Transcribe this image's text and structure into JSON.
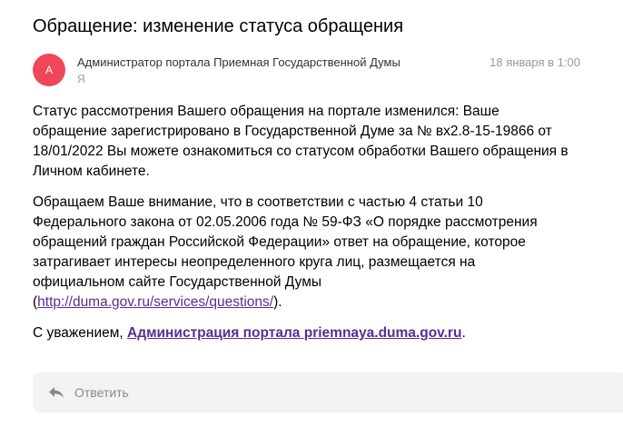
{
  "email": {
    "subject": "Обращение: изменение статуса обращения",
    "avatar_letter": "А",
    "avatar_color": "#f0465a",
    "sender": "Администратор портала Приемная Государственной Думы",
    "recipient": "Я",
    "date": "18 января в 1:00"
  },
  "body": {
    "p1": [
      "Статус рассмотрения Вашего обращения на портале изменился: Ваше",
      "обращение зарегистрировано в Государственной Думе за № вх2.8-15-19866 от",
      "18/01/2022 Вы можете ознакомиться со статусом обработки Вашего обращения в",
      "Личном кабинете."
    ],
    "p2": [
      "Обращаем Ваше внимание, что в соответствии с частью 4 статьи 10",
      "Федерального закона от 02.05.2006 года № 59-ФЗ «О порядке рассмотрения",
      "обращений граждан Российской Федерации» ответ на обращение, которое",
      "затрагивает интересы неопределенного круга лиц, размещается на",
      "официальном сайте Государственной Думы"
    ],
    "p2_link_open": "(",
    "p2_link": "http://duma.gov.ru/services/questions/",
    "p2_link_close": ").",
    "signature_prefix": "С уважением, ",
    "signature_link": "Администрация портала priemnaya.duma.gov.ru",
    "signature_suffix": "."
  },
  "reply": {
    "label": "Ответить",
    "icon": "reply-arrow-icon"
  },
  "colors": {
    "link": "#5a2d91",
    "muted": "#999999",
    "reply_bg": "#f3f3f5"
  }
}
